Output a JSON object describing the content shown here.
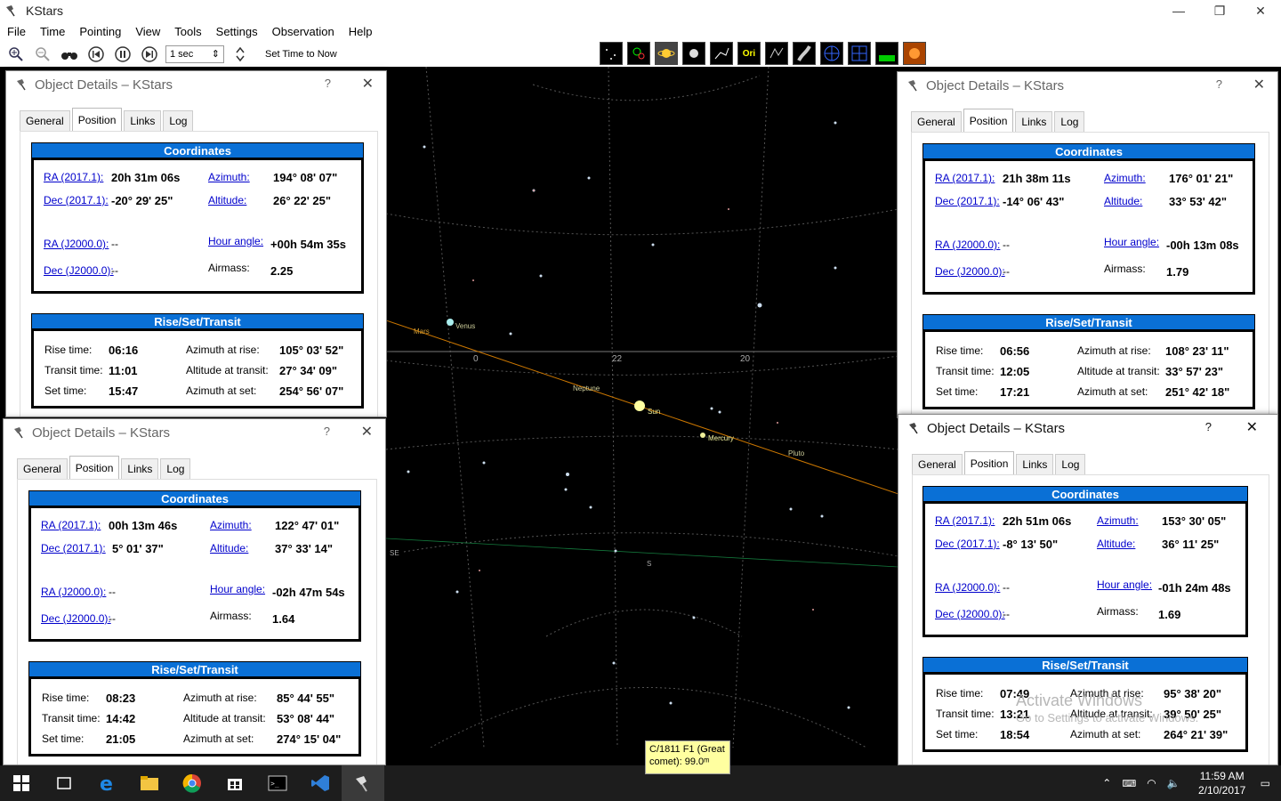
{
  "app": {
    "title": "KStars",
    "minimize": "—",
    "restore": "❐",
    "close": "✕"
  },
  "menu": [
    "File",
    "Time",
    "Pointing",
    "View",
    "Tools",
    "Settings",
    "Observation",
    "Help"
  ],
  "toolbar": {
    "timestep": "1 sec",
    "set_time_label": "Set Time to Now",
    "view_toggle_3": "Ori"
  },
  "skymap": {
    "labels": {
      "mars": "Mars",
      "venus": "Venus",
      "neptune": "Neptune",
      "sun": "Sun",
      "mercury": "Mercury",
      "pluto": "Pluto",
      "ra0": "0",
      "ra22": "22",
      "ra20": "20",
      "se": "SE",
      "s": "S"
    }
  },
  "dialogs": [
    {
      "title": "Object Details – KStars",
      "tabs": [
        "General",
        "Position",
        "Links",
        "Log"
      ],
      "coords_head": "Coordinates",
      "ra_label": "RA (2017.1):",
      "ra_val": "20h 31m 06s",
      "az_label": "Azimuth:",
      "az_val": "194° 08' 07\"",
      "dec_label": "Dec (2017.1):",
      "dec_val": "-20° 29' 25\"",
      "alt_label": "Altitude:",
      "alt_val": "26° 22' 25\"",
      "ra2000_label": "RA (J2000.0):",
      "ra2000_val": "--",
      "ha_label": "Hour angle:",
      "ha_val": "+00h 54m 35s",
      "dec2000_label": "Dec (J2000.0):",
      "dec2000_val": "--",
      "am_label": "Airmass:",
      "am_val": "2.25",
      "rst_head": "Rise/Set/Transit",
      "rise_label": "Rise time:",
      "rise_val": "06:16",
      "azrise_label": "Azimuth at rise:",
      "azrise_val": "105° 03' 52\"",
      "transit_label": "Transit time:",
      "transit_val": "11:01",
      "alttr_label": "Altitude at transit:",
      "alttr_val": "27° 34' 09\"",
      "set_label": "Set time:",
      "set_val": "15:47",
      "azset_label": "Azimuth at set:",
      "azset_val": "254° 56' 07\""
    },
    {
      "title": "Object Details – KStars",
      "tabs": [
        "General",
        "Position",
        "Links",
        "Log"
      ],
      "coords_head": "Coordinates",
      "ra_label": "RA (2017.1):",
      "ra_val": "21h 38m 11s",
      "az_label": "Azimuth:",
      "az_val": "176° 01' 21\"",
      "dec_label": "Dec (2017.1):",
      "dec_val": "-14° 06' 43\"",
      "alt_label": "Altitude:",
      "alt_val": "33° 53' 42\"",
      "ra2000_label": "RA (J2000.0):",
      "ra2000_val": "--",
      "ha_label": "Hour angle:",
      "ha_val": "-00h 13m 08s",
      "dec2000_label": "Dec (J2000.0):",
      "dec2000_val": "--",
      "am_label": "Airmass:",
      "am_val": "1.79",
      "rst_head": "Rise/Set/Transit",
      "rise_label": "Rise time:",
      "rise_val": "06:56",
      "azrise_label": "Azimuth at rise:",
      "azrise_val": "108° 23' 11\"",
      "transit_label": "Transit time:",
      "transit_val": "12:05",
      "alttr_label": "Altitude at transit:",
      "alttr_val": "33° 57' 23\"",
      "set_label": "Set time:",
      "set_val": "17:21",
      "azset_label": "Azimuth at set:",
      "azset_val": "251° 42' 18\""
    },
    {
      "title": "Object Details – KStars",
      "tabs": [
        "General",
        "Position",
        "Links",
        "Log"
      ],
      "coords_head": "Coordinates",
      "ra_label": "RA (2017.1):",
      "ra_val": "00h 13m 46s",
      "az_label": "Azimuth:",
      "az_val": "122° 47' 01\"",
      "dec_label": "Dec (2017.1):",
      "dec_val": "5° 01' 37\"",
      "alt_label": "Altitude:",
      "alt_val": "37° 33' 14\"",
      "ra2000_label": "RA (J2000.0):",
      "ra2000_val": "--",
      "ha_label": "Hour angle:",
      "ha_val": "-02h 47m 54s",
      "dec2000_label": "Dec (J2000.0):",
      "dec2000_val": "--",
      "am_label": "Airmass:",
      "am_val": "1.64",
      "rst_head": "Rise/Set/Transit",
      "rise_label": "Rise time:",
      "rise_val": "08:23",
      "azrise_label": "Azimuth at rise:",
      "azrise_val": "85° 44' 55\"",
      "transit_label": "Transit time:",
      "transit_val": "14:42",
      "alttr_label": "Altitude at transit:",
      "alttr_val": "53° 08' 44\"",
      "set_label": "Set time:",
      "set_val": "21:05",
      "azset_label": "Azimuth at set:",
      "azset_val": "274° 15' 04\""
    },
    {
      "title": "Object Details – KStars",
      "tabs": [
        "General",
        "Position",
        "Links",
        "Log"
      ],
      "coords_head": "Coordinates",
      "ra_label": "RA (2017.1):",
      "ra_val": "22h 51m 06s",
      "az_label": "Azimuth:",
      "az_val": "153° 30' 05\"",
      "dec_label": "Dec (2017.1):",
      "dec_val": "-8° 13' 50\"",
      "alt_label": "Altitude:",
      "alt_val": "36° 11' 25\"",
      "ra2000_label": "RA (J2000.0):",
      "ra2000_val": "--",
      "ha_label": "Hour angle:",
      "ha_val": "-01h 24m 48s",
      "dec2000_label": "Dec (J2000.0):",
      "dec2000_val": "--",
      "am_label": "Airmass:",
      "am_val": "1.69",
      "rst_head": "Rise/Set/Transit",
      "rise_label": "Rise time:",
      "rise_val": "07:49",
      "azrise_label": "Azimuth at rise:",
      "azrise_val": "95° 38' 20\"",
      "transit_label": "Transit time:",
      "transit_val": "13:21",
      "alttr_label": "Altitude at transit:",
      "alttr_val": "39° 50' 25\"",
      "set_label": "Set time:",
      "set_val": "18:54",
      "azset_label": "Azimuth at set:",
      "azset_val": "264° 21' 39\""
    }
  ],
  "tooltip": {
    "line1": "C/1811 F1 (Great",
    "line2": "comet): 99.0ᵐ"
  },
  "watermark": {
    "line1": "Activate Windows",
    "line2": "Go to Settings to activate Windows."
  },
  "taskbar": {
    "time": "11:59 AM",
    "date": "2/10/2017"
  }
}
